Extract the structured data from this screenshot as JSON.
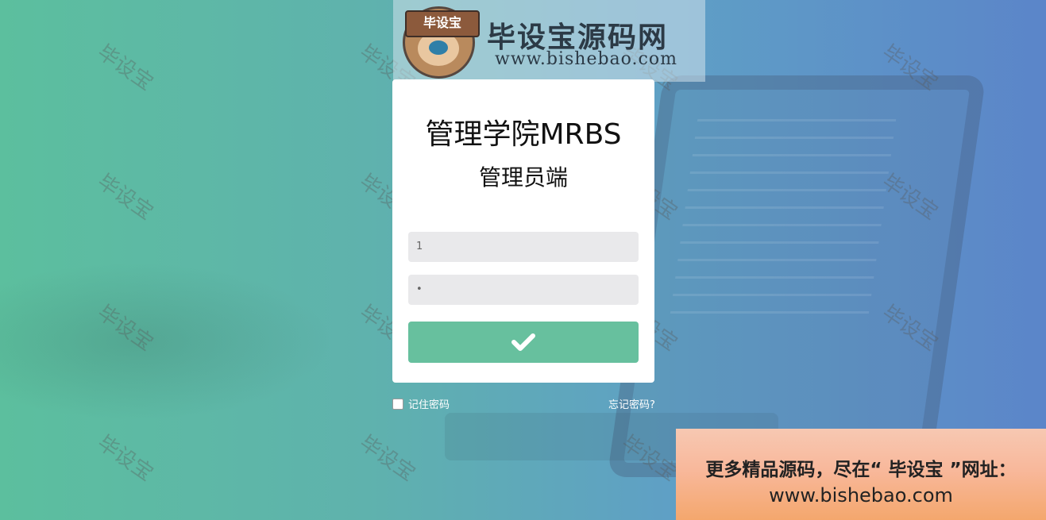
{
  "watermark_text": "毕设宝",
  "logo": {
    "sign_text": "毕设宝",
    "site_name": "毕设宝源码网",
    "url": "www.bishebao.com"
  },
  "login": {
    "title": "管理学院MRBS",
    "subtitle": "管理员端",
    "username_value": "1",
    "password_value": "•",
    "submit_icon": "check-icon",
    "remember_label": "记住密码",
    "forgot_label": "忘记密码?"
  },
  "promo": {
    "line1": "更多精品源码，尽在“ 毕设宝 ”网址：",
    "line2": "www.bishebao.com"
  },
  "colors": {
    "accent": "#67c09e",
    "card": "#ffffff",
    "input_bg": "#e9e9eb"
  }
}
